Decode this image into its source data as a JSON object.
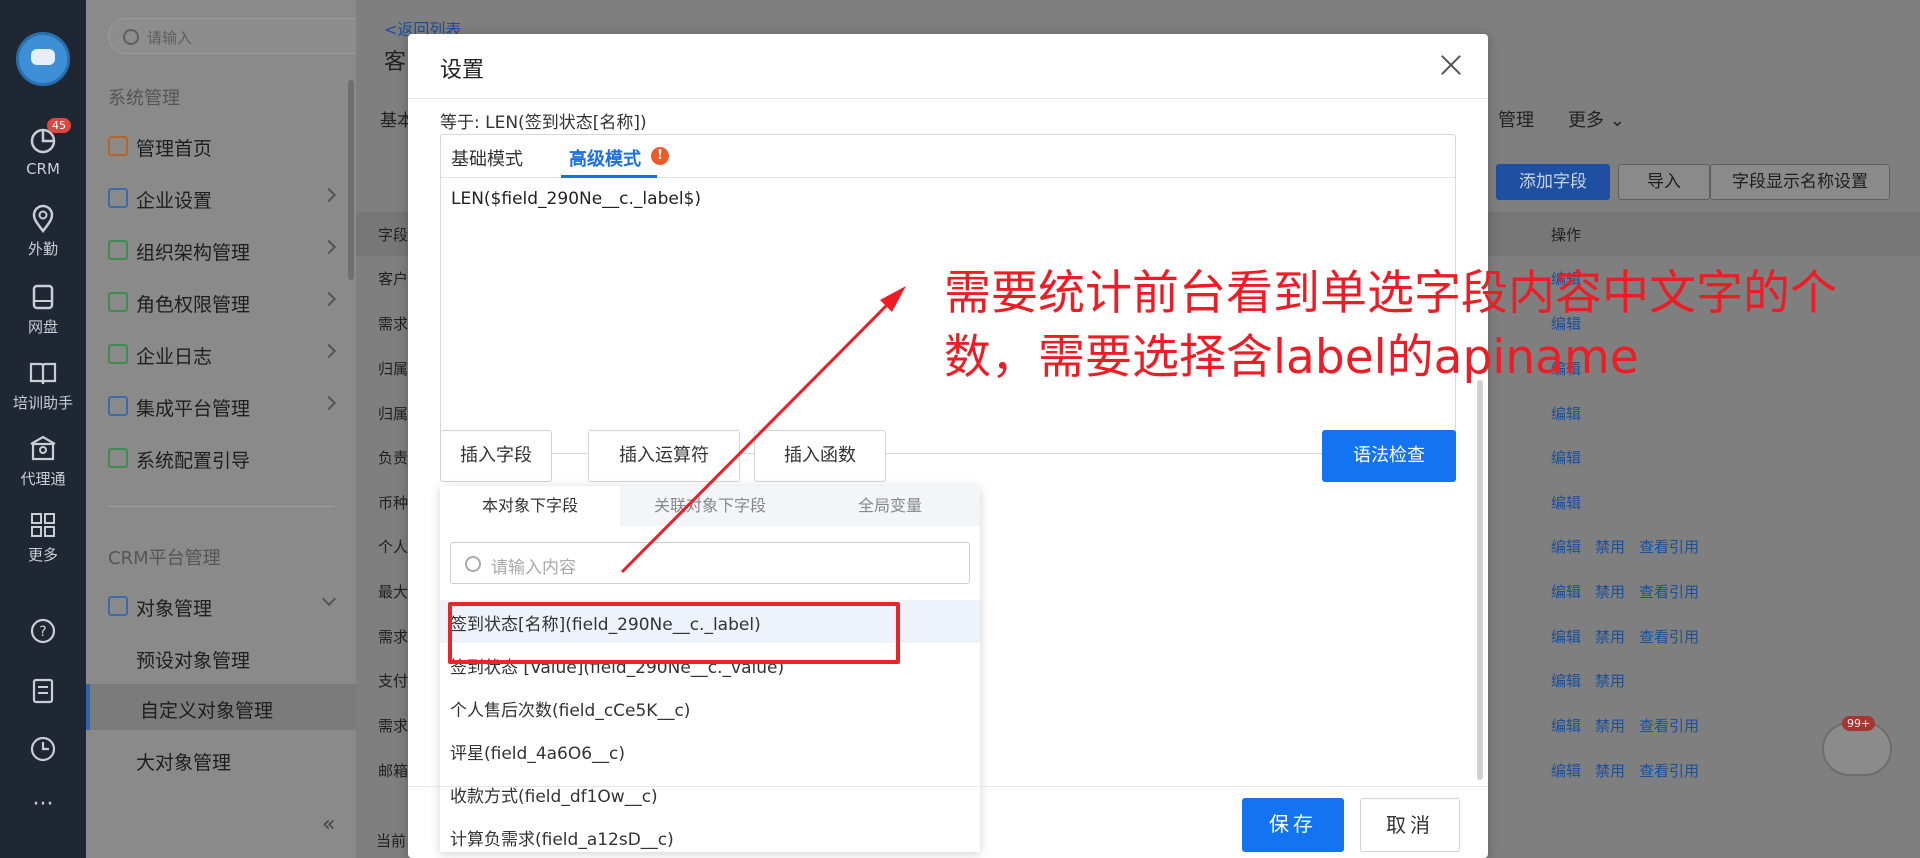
{
  "rail": {
    "items": [
      {
        "label": "CRM",
        "badge": "45",
        "icon": "pie-chart-icon"
      },
      {
        "label": "外勤",
        "icon": "location-pin-icon"
      },
      {
        "label": "网盘",
        "icon": "disk-icon"
      },
      {
        "label": "培训助手",
        "icon": "book-icon"
      },
      {
        "label": "代理通",
        "icon": "building-icon"
      },
      {
        "label": "更多",
        "icon": "grid-icon"
      }
    ],
    "bottom_icons": [
      "help-icon",
      "notes-icon",
      "clock-icon",
      "more-dots-icon"
    ],
    "more_dots": "···"
  },
  "menu": {
    "search_placeholder": "请输入",
    "group1": "系统管理",
    "items": [
      {
        "label": "管理首页"
      },
      {
        "label": "企业设置"
      },
      {
        "label": "组织架构管理"
      },
      {
        "label": "角色权限管理"
      },
      {
        "label": "企业日志"
      },
      {
        "label": "集成平台管理"
      },
      {
        "label": "系统配置引导"
      }
    ],
    "group2": "CRM平台管理",
    "object_mgmt": "对象管理",
    "subitems": [
      "预设对象管理",
      "自定义对象管理",
      "大对象管理"
    ],
    "collapse": "«"
  },
  "page": {
    "back": "<返回列表",
    "title_fragment": "客",
    "tab_fragment": "基本",
    "tab_mgmt": "管理",
    "tab_more": "更多",
    "add_field": "添加字段",
    "import": "导入",
    "field_display": "字段显示名称设置",
    "col_field": "字段",
    "col_ops": "操作",
    "rows": [
      "客户",
      "需求",
      "归属",
      "归属",
      "负责",
      "币种",
      "个人",
      "最大",
      "需求",
      "支付",
      "需求",
      "邮箱"
    ],
    "op_edit": "编辑",
    "op_disable": "禁用",
    "op_ref": "查看引用",
    "current": "当前",
    "chat_badge": "99+"
  },
  "modal": {
    "title": "设置",
    "equals": "等于: LEN(签到状态[名称])",
    "tab_basic": "基础模式",
    "tab_advanced": "高级模式",
    "warn": "!",
    "formula": "LEN($field_290Ne__c._label$)",
    "insert_field": "插入字段",
    "insert_operator": "插入运算符",
    "insert_function": "插入函数",
    "syntax_check": "语法检查",
    "save": "保存",
    "cancel": "取消"
  },
  "dropdown": {
    "tabs": [
      "本对象下字段",
      "关联对象下字段",
      "全局变量"
    ],
    "search_placeholder": "请输入内容",
    "items": [
      "签到状态[名称](field_290Ne__c._label)",
      "签到状态 [Value](field_290Ne__c._value)",
      "个人售后次数(field_cCe5K__c)",
      "评星(field_4a6O6__c)",
      "收款方式(field_df1Ow__c)",
      "计算负需求(field_a12sD__c)"
    ]
  },
  "annotation": {
    "text": "需要统计前台看到单选字段内容中文字的个数，需要选择含label的apiname",
    "color": "#ee1c24"
  },
  "colors": {
    "accent": "#1473f0",
    "annotation_red": "#e8262a"
  }
}
